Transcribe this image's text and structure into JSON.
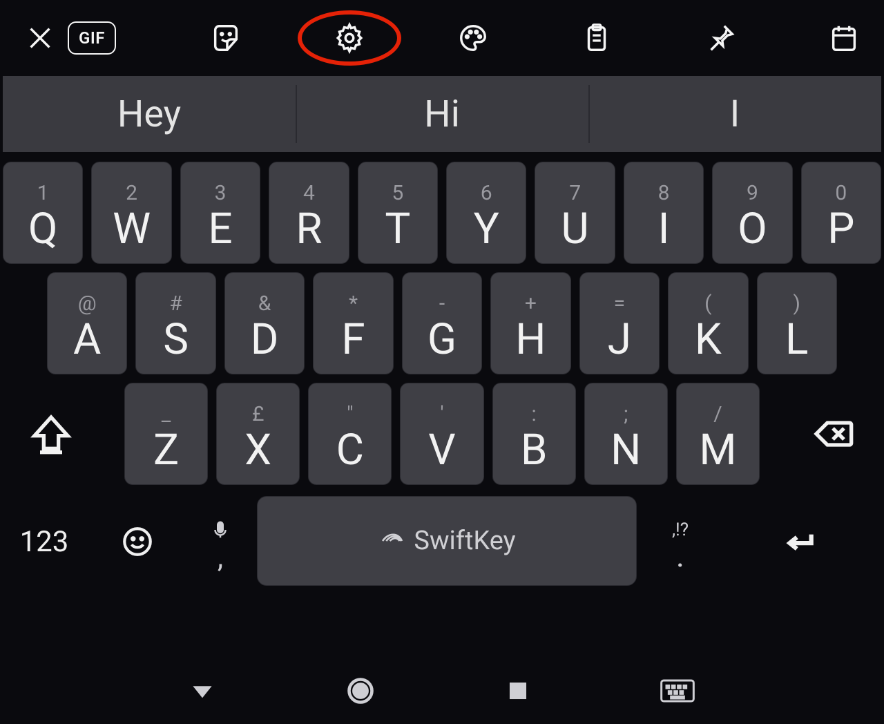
{
  "toolbar": {
    "gif_label": "GIF"
  },
  "suggestions": [
    "Hey",
    "Hi",
    "I"
  ],
  "rows": {
    "r1": [
      {
        "hint": "1",
        "main": "Q"
      },
      {
        "hint": "2",
        "main": "W"
      },
      {
        "hint": "3",
        "main": "E"
      },
      {
        "hint": "4",
        "main": "R"
      },
      {
        "hint": "5",
        "main": "T"
      },
      {
        "hint": "6",
        "main": "Y"
      },
      {
        "hint": "7",
        "main": "U"
      },
      {
        "hint": "8",
        "main": "I"
      },
      {
        "hint": "9",
        "main": "O"
      },
      {
        "hint": "0",
        "main": "P"
      }
    ],
    "r2": [
      {
        "hint": "@",
        "main": "A"
      },
      {
        "hint": "#",
        "main": "S"
      },
      {
        "hint": "&",
        "main": "D"
      },
      {
        "hint": "*",
        "main": "F"
      },
      {
        "hint": "-",
        "main": "G"
      },
      {
        "hint": "+",
        "main": "H"
      },
      {
        "hint": "=",
        "main": "J"
      },
      {
        "hint": "(",
        "main": "K"
      },
      {
        "hint": ")",
        "main": "L"
      }
    ],
    "r3": [
      {
        "hint": "_",
        "main": "Z"
      },
      {
        "hint": "£",
        "main": "X"
      },
      {
        "hint": "\"",
        "main": "C"
      },
      {
        "hint": "'",
        "main": "V"
      },
      {
        "hint": ":",
        "main": "B"
      },
      {
        "hint": ";",
        "main": "N"
      },
      {
        "hint": "/",
        "main": "M"
      }
    ]
  },
  "bottom": {
    "mode_label": "123",
    "mic_comma": ",",
    "space_label": "SwiftKey",
    "punct_hint": ",!?",
    "punct_main": "."
  }
}
